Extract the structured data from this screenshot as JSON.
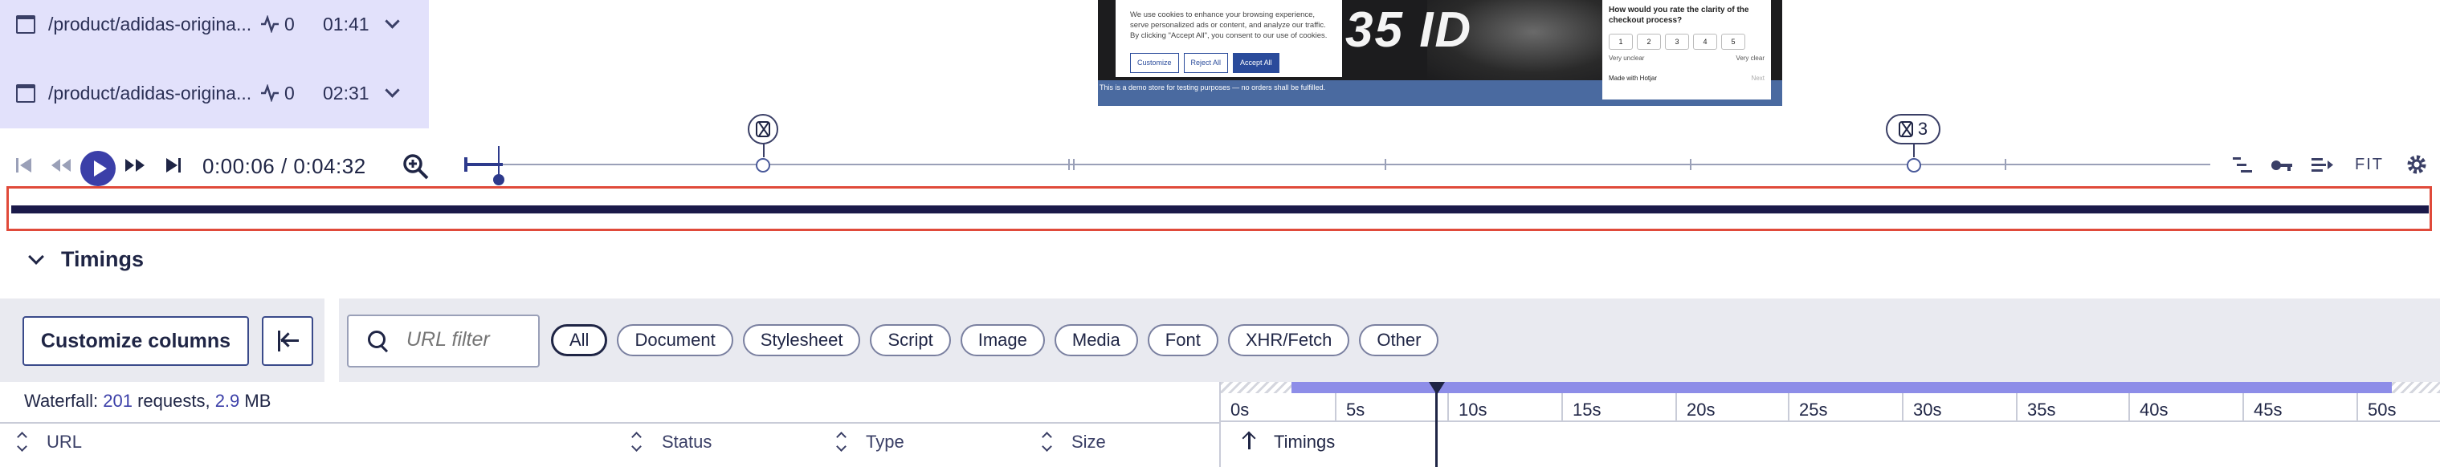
{
  "sessions": [
    {
      "url": "/product/adidas-origina...",
      "activity": "0",
      "duration": "01:41"
    },
    {
      "url": "/product/adidas-origina...",
      "activity": "0",
      "duration": "02:31"
    }
  ],
  "preview": {
    "cookie_text": "We use cookies to enhance your browsing experience, serve personalized ads or content, and analyze our traffic. By clicking \"Accept All\", you consent to our use of cookies.",
    "btn_customize": "Customize",
    "btn_reject": "Reject All",
    "btn_accept": "Accept All",
    "big_text": "35 ID",
    "survey_question": "How would you rate the clarity of the checkout process?",
    "survey_nums": [
      "1",
      "2",
      "3",
      "4",
      "5"
    ],
    "scale_low": "Very unclear",
    "scale_high": "Very clear",
    "made_with": "Made with Hotjar",
    "next": "Next",
    "demo_banner": "This is a demo store for testing purposes — no orders shall be fulfilled."
  },
  "player": {
    "current_time": "0:00:06",
    "total_time": "0:04:32",
    "time_display": "0:00:06 / 0:04:32",
    "badge_count": "3",
    "fit_label": "FIT"
  },
  "timings": {
    "title": "Timings",
    "customize_label": "Customize columns",
    "url_placeholder": "URL filter",
    "filters": [
      "All",
      "Document",
      "Stylesheet",
      "Script",
      "Image",
      "Media",
      "Font",
      "XHR/Fetch",
      "Other"
    ],
    "selected_filter": "All",
    "waterfall_prefix": "Waterfall:",
    "request_count": "201",
    "requests_word": "requests,",
    "total_size": "2.9",
    "size_unit": "MB",
    "columns": [
      "URL",
      "Status",
      "Type",
      "Size"
    ],
    "timings_col": "Timings",
    "scale_ticks": [
      "0s",
      "5s",
      "10s",
      "15s",
      "20s",
      "25s",
      "30s",
      "35s",
      "40s",
      "45s",
      "50s"
    ]
  },
  "colors": {
    "accent": "#3b3fa8",
    "highlight": "#e04a3a",
    "track": "#1b1a4a",
    "range": "#8d8de8"
  }
}
